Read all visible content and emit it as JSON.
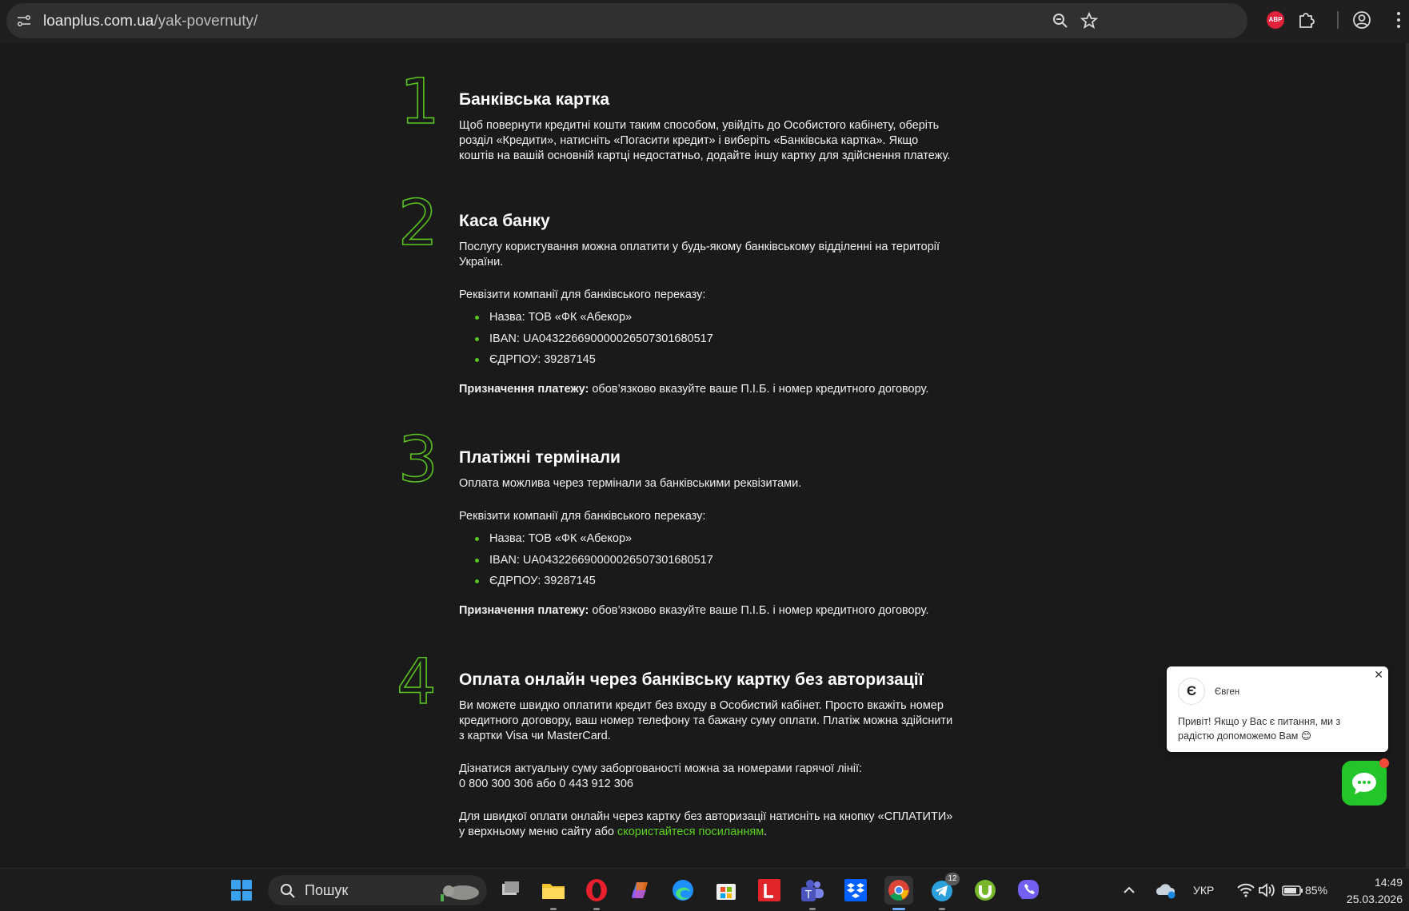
{
  "browser": {
    "url_host": "loanplus.com.ua",
    "url_path": "/yak-povernuty/"
  },
  "steps": [
    {
      "number": "1",
      "title": "Банківська картка",
      "text": "Щоб повернути кредитні кошти таким способом, увійдіть до Особистого кабінету, оберіть розділ «Кредити», натисніть «Погасити кредит» і виберіть «Банківська картка». Якщо коштів на вашій основній картці недостатньо, додайте іншу картку для здійснення платежу."
    },
    {
      "number": "2",
      "title": "Каса банку",
      "text": "Послугу користування можна оплатити у будь-якому банківському відділенні на території України.",
      "requisites_label": "Реквізити компанії для банківського переказу:",
      "requisites": [
        "Назва: ТОВ «ФК «Абекор»",
        "IBAN: UA043226690000026507301680517",
        "ЄДРПОУ: 39287145"
      ],
      "purpose_label": "Призначення платежу:",
      "purpose_text": " обов’язково вказуйте ваше П.І.Б. і номер кредитного договору."
    },
    {
      "number": "3",
      "title": "Платіжні термінали",
      "text": "Оплата можлива через термінали за банківськими реквізитами.",
      "requisites_label": "Реквізити компанії для банківського переказу:",
      "requisites": [
        "Назва: ТОВ «ФК «Абекор»",
        "IBAN: UA043226690000026507301680517",
        "ЄДРПОУ: 39287145"
      ],
      "purpose_label": "Призначення платежу:",
      "purpose_text": " обов’язково вказуйте ваше П.І.Б. і номер кредитного договору."
    },
    {
      "number": "4",
      "title": "Оплата онлайн через банківську картку без авторизації",
      "text": "Ви можете швидко оплатити кредит без входу в Особистий кабінет. Просто вкажіть номер кредитного договору, ваш номер телефону та бажану суму оплати. Платіж можна здійснити з картки Visa чи MasterCard.",
      "hotline_text": "Дізнатися актуальну суму заборгованості можна за номерами гарячої лінії:",
      "hotline_numbers": "0 800 300 306 або 0 443 912 306",
      "quickpay_text": "Для швидкої оплати онлайн через картку без авторизації натисніть на кнопку «СПЛАТИТИ» у верхньому меню сайту або ",
      "quickpay_link": "скористайтеся посиланням",
      "quickpay_end": "."
    }
  ],
  "chat": {
    "avatar_letter": "Є",
    "agent_name": "Євген",
    "message": "Привіт! Якщо у Вас є питання, ми з радістю допоможемо Вам 😊",
    "close_symbol": "✕"
  },
  "taskbar": {
    "search_placeholder": "Пошук",
    "telegram_badge": "12",
    "language": "УКР",
    "battery": "85%",
    "time": "14:49",
    "date": "25.03.2026"
  },
  "colors": {
    "accent_green": "#59c21e",
    "page_background": "#1a1a1a",
    "chat_button": "#22c52a",
    "abp_red": "#e0223b"
  },
  "icons": {
    "browser": [
      "site-settings-icon",
      "zoom-icon",
      "bookmark-star-icon",
      "adblock-plus-icon",
      "extensions-icon",
      "profile-icon",
      "menu-dots-icon"
    ],
    "taskbar": [
      "windows-start-icon",
      "search-icon",
      "task-view-icon",
      "file-explorer-icon",
      "opera-icon",
      "copilot-icon",
      "edge-icon",
      "microsoft-store-icon",
      "l-app-icon",
      "teams-icon",
      "dropbox-icon",
      "chrome-icon",
      "telegram-icon",
      "utorrent-icon",
      "viber-icon"
    ]
  }
}
